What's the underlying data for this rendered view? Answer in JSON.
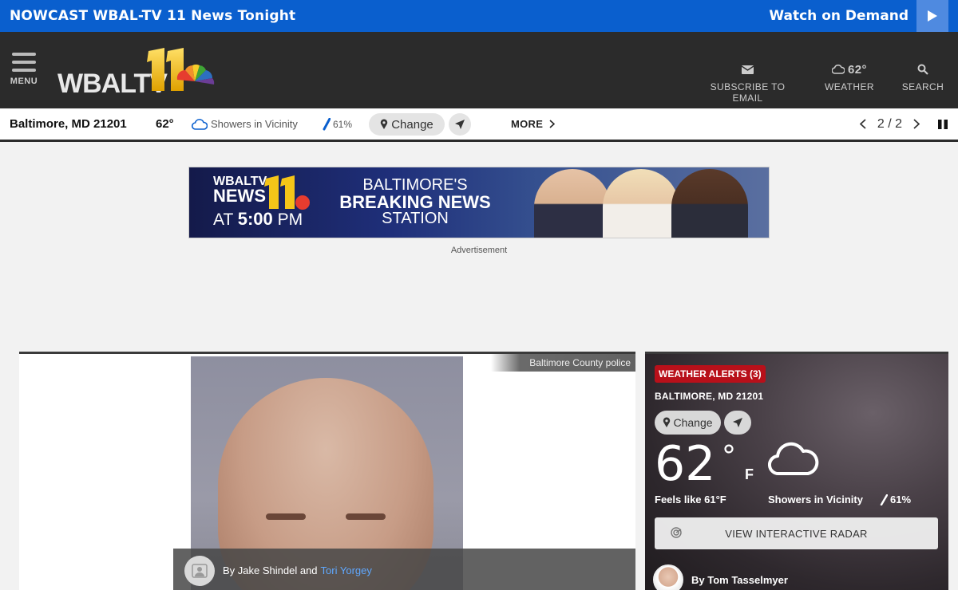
{
  "livebar": {
    "title": "NOWCAST WBAL-TV 11 News Tonight",
    "watch_label": "Watch on Demand",
    "accent_color": "#0a5fce"
  },
  "header": {
    "menu_label": "MENU",
    "logo_text": "WBALTV 11",
    "subscribe_label": "SUBSCRIBE TO EMAIL",
    "weather_temp": "62°",
    "weather_label": "WEATHER",
    "search_label": "SEARCH"
  },
  "weather_strip": {
    "location": "Baltimore, MD 21201",
    "temp": "62°",
    "condition": "Showers in Vicinity",
    "humidity": "61%",
    "change_label": "Change",
    "more_label": "MORE",
    "pager": "2 / 2"
  },
  "ad": {
    "logo_line1": "WBALTV",
    "logo_line2": "NEWS",
    "logo_line3_prefix": "AT",
    "logo_line3_time": "5:00",
    "logo_line3_suffix": "PM",
    "line1": "BALTIMORE'S",
    "line2": "BREAKING NEWS",
    "line3": "STATION",
    "label": "Advertisement"
  },
  "article": {
    "photo_credit": "Baltimore County police",
    "byline_prefix": "By Jake Shindel and",
    "byline_author2": "Tori Yorgey"
  },
  "weather_widget": {
    "alerts_label": "WEATHER ALERTS (3)",
    "city": "BALTIMORE, MD 21201",
    "change_label": "Change",
    "temp": "62",
    "degree": "°",
    "unit": "F",
    "feels_like": "Feels like 61°F",
    "condition": "Showers in Vicinity",
    "humidity": "61%",
    "radar_label": "VIEW INTERACTIVE RADAR",
    "forecaster": "By Tom Tasselmyer",
    "alert_color": "#b8101a"
  }
}
